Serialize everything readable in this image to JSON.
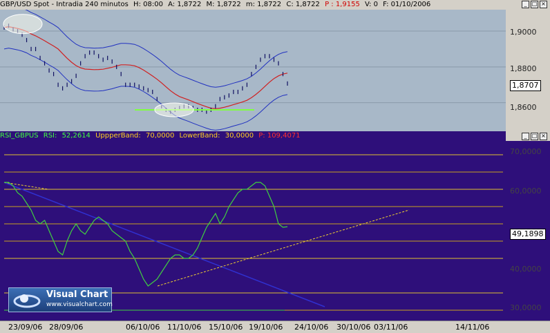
{
  "price_panel": {
    "title": "GBP/USD Spot - Intradia 240 minutos",
    "h": "H: 08:00",
    "a": "A: 1,8722",
    "m_high": "M: 1,8722",
    "m_low": "m: 1,8722",
    "c": "C: 1,8722",
    "p": "P : 1,9155",
    "v": "V: 0",
    "f": "F: 01/10/2006",
    "current_value": "1,8707",
    "y_ticks": [
      "1,9000",
      "1,8800",
      "1,8600"
    ]
  },
  "rsi_panel": {
    "name": "RSI_GBPUS",
    "rsi_label": "RSI:",
    "rsi_value": "52,2614",
    "upper_label": "UppperBand:",
    "upper_value": "70,0000",
    "lower_label": "LowerBand:",
    "lower_value": "30,0000",
    "p_label": "P: 109,4071",
    "current_value": "49,1898",
    "y_ticks": [
      "70,0000",
      "60,0000",
      "40,0000",
      "30,0000"
    ]
  },
  "dates": [
    "23/09/06",
    "28/09/06",
    "06/10/06",
    "11/10/06",
    "15/10/06",
    "19/10/06",
    "24/10/06",
    "30/10/06",
    "03/11/06",
    "14/11/06"
  ],
  "logo": {
    "name": "Visual Chart",
    "url": "www.visualchart.com"
  },
  "colors": {
    "price_bg": "#a8b8c8",
    "rsi_bg": "#2e0f7a",
    "upper_band": "#2030c0",
    "mid_band": "#d02020",
    "rsi_line": "#40d040",
    "trend_blue": "#3030d0",
    "trend_yellow": "#f0d030",
    "support": "#80ff40"
  },
  "chart_data": [
    {
      "type": "line",
      "title": "GBP/USD Spot - Intradia 240 minutos",
      "ylim": [
        1.844,
        1.912
      ],
      "series": [
        {
          "values": [
            1.902,
            1.903,
            1.901,
            1.9,
            1.898,
            1.895,
            1.89,
            1.89,
            1.885,
            1.882,
            1.878,
            1.876,
            1.87,
            1.868,
            1.87,
            1.872,
            1.875,
            1.882,
            1.886,
            1.888,
            1.888,
            1.886,
            1.884,
            1.885,
            1.883,
            1.88,
            1.876,
            1.87,
            1.87,
            1.87,
            1.869,
            1.868,
            1.867,
            1.866,
            1.862,
            1.858,
            1.856,
            1.855,
            1.856,
            1.857,
            1.858,
            1.858,
            1.857,
            1.856,
            1.856,
            1.855,
            1.856,
            1.858,
            1.862,
            1.863,
            1.864,
            1.866,
            1.866,
            1.868,
            1.87,
            1.876,
            1.88,
            1.884,
            1.886,
            1.886,
            1.884,
            1.882,
            1.876,
            1.8707
          ]
        }
      ]
    },
    {
      "type": "line",
      "name": "RSI_GBPUS",
      "ylim": [
        22,
        74
      ],
      "series": [
        {
          "values": [
            62,
            62,
            61,
            59,
            58,
            56,
            54,
            51,
            50,
            51,
            48,
            45,
            42,
            41,
            45,
            48,
            50,
            48,
            47,
            49,
            51,
            52,
            51,
            50,
            48,
            47,
            46,
            45,
            42,
            40,
            37,
            34,
            32,
            33,
            34,
            36,
            38,
            40,
            41,
            41,
            40,
            40,
            41,
            43,
            46,
            49,
            51,
            53,
            50,
            52,
            55,
            57,
            59,
            60,
            60,
            61,
            62,
            62,
            61,
            58,
            55,
            50,
            49,
            49.19
          ]
        },
        {
          "values": [
            70,
            70,
            70,
            70,
            70,
            70,
            70,
            70,
            70,
            70,
            70,
            70,
            70,
            70,
            70,
            70,
            70,
            70,
            70,
            70,
            70,
            70,
            70,
            70,
            70,
            70,
            70,
            70,
            70,
            70,
            70,
            70,
            70,
            70,
            70,
            70,
            70,
            70,
            70,
            70,
            70,
            70,
            70,
            70,
            70,
            70,
            70,
            70,
            70,
            70,
            70,
            70,
            70,
            70,
            70,
            70,
            70,
            70,
            70,
            70,
            70,
            70,
            70,
            70
          ]
        },
        {
          "values": [
            30,
            30,
            30,
            30,
            30,
            30,
            30,
            30,
            30,
            30,
            30,
            30,
            30,
            30,
            30,
            30,
            30,
            30,
            30,
            30,
            30,
            30,
            30,
            30,
            30,
            30,
            30,
            30,
            30,
            30,
            30,
            30,
            30,
            30,
            30,
            30,
            30,
            30,
            30,
            30,
            30,
            30,
            30,
            30,
            30,
            30,
            30,
            30,
            30,
            30,
            30,
            30,
            30,
            30,
            30,
            30,
            30,
            30,
            30,
            30,
            30,
            30,
            30,
            30
          ]
        }
      ]
    }
  ]
}
